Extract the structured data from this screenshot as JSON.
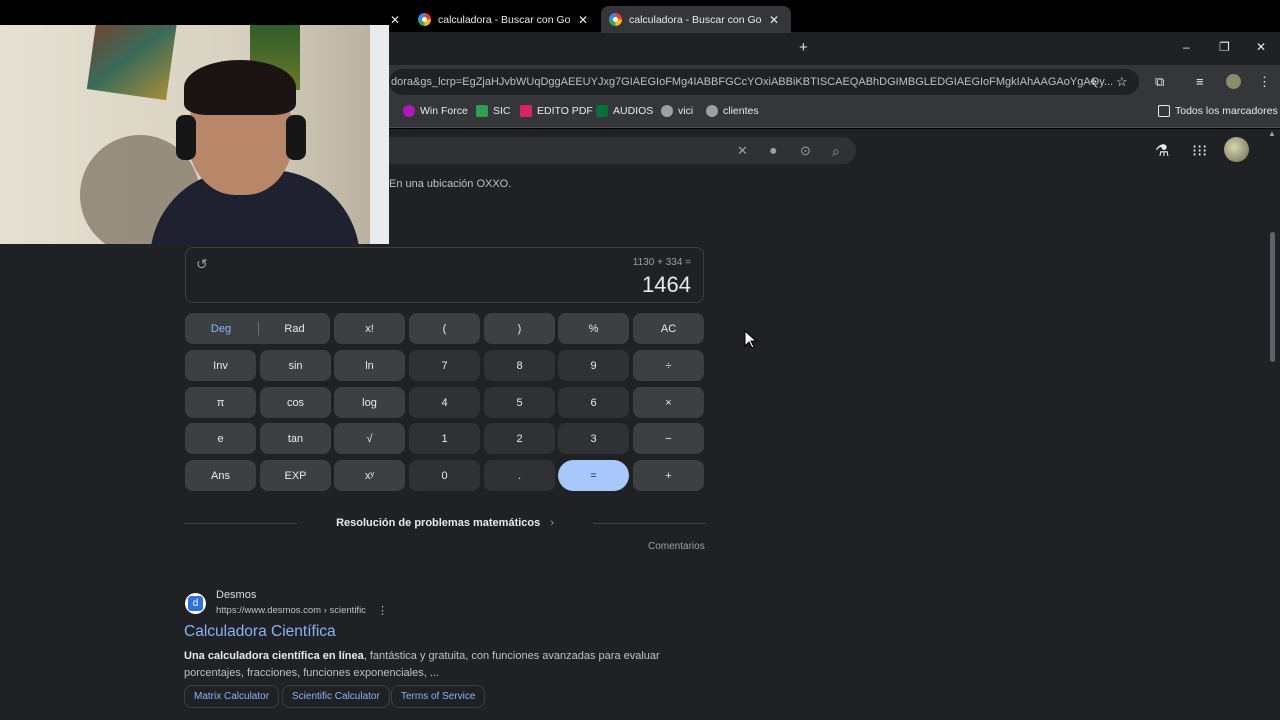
{
  "browser": {
    "tabs": [
      {
        "title": "calculadora - Buscar con Googl",
        "close": "✕"
      },
      {
        "title": "calculadora - Buscar con Googl",
        "close": "✕"
      }
    ],
    "left_tab_close": "✕",
    "new_tab": "+",
    "window_controls": {
      "minimize": "–",
      "restore": "❐",
      "close": "✕"
    },
    "url": "dora&gs_lcrp=EgZjaHJvbWUqDggAEEUYJxg7GIAEGIoFMg4IABBFGCcYOxiABBiKBTISCAEQABhDGIMBGLEDGIAEGIoFMgkIAhAAGAoYgAQy...",
    "bookmarks": [
      {
        "label": "Win Force",
        "color": "#b01ab8"
      },
      {
        "label": "SIC",
        "color": "#2e9e4f"
      },
      {
        "label": "EDITO PDF",
        "color": "#d4246b"
      },
      {
        "label": "AUDIOS",
        "color": "#0a6d3a"
      },
      {
        "label": "vici",
        "color": "#5f6368"
      },
      {
        "label": "clientes",
        "color": "#5f6368"
      }
    ],
    "all_bookmarks": "Todos los marcadores"
  },
  "search": {
    "clear_icon": "✕",
    "mic_icon": "🎤",
    "lens_icon": "⊙",
    "search_icon": "⌕"
  },
  "page": {
    "oxxo_text": "En una ubicación OXXO."
  },
  "calculator": {
    "history_icon": "↺",
    "expression": "1130 + 334 =",
    "result": "1464",
    "deg": "Deg",
    "rad": "Rad",
    "keys": [
      [
        "x!",
        "(",
        ")",
        "%",
        "AC"
      ],
      [
        "Inv",
        "sin",
        "ln",
        "7",
        "8",
        "9",
        "÷"
      ],
      [
        "π",
        "cos",
        "log",
        "4",
        "5",
        "6",
        "×"
      ],
      [
        "e",
        "tan",
        "√",
        "1",
        "2",
        "3",
        "−"
      ],
      [
        "Ans",
        "EXP",
        "xʸ",
        "0",
        ".",
        "=",
        "+"
      ]
    ],
    "math_button": "Resolución de problemas matemáticos",
    "math_chevron": "›",
    "feedback": "Comentarios"
  },
  "result": {
    "logo_letter": "d",
    "site": "Desmos",
    "cite": "https://www.desmos.com › scientific",
    "menu": "⋮",
    "title": "Calculadora Científica",
    "snippet_bold": "Una calculadora científica en línea",
    "snippet_rest": ", fantástica y gratuita, con funciones avanzadas para evaluar porcentajes, fracciones, funciones exponenciales, ...",
    "chips": [
      "Matrix Calculator",
      "Scientific Calculator",
      "Terms of Service"
    ]
  }
}
